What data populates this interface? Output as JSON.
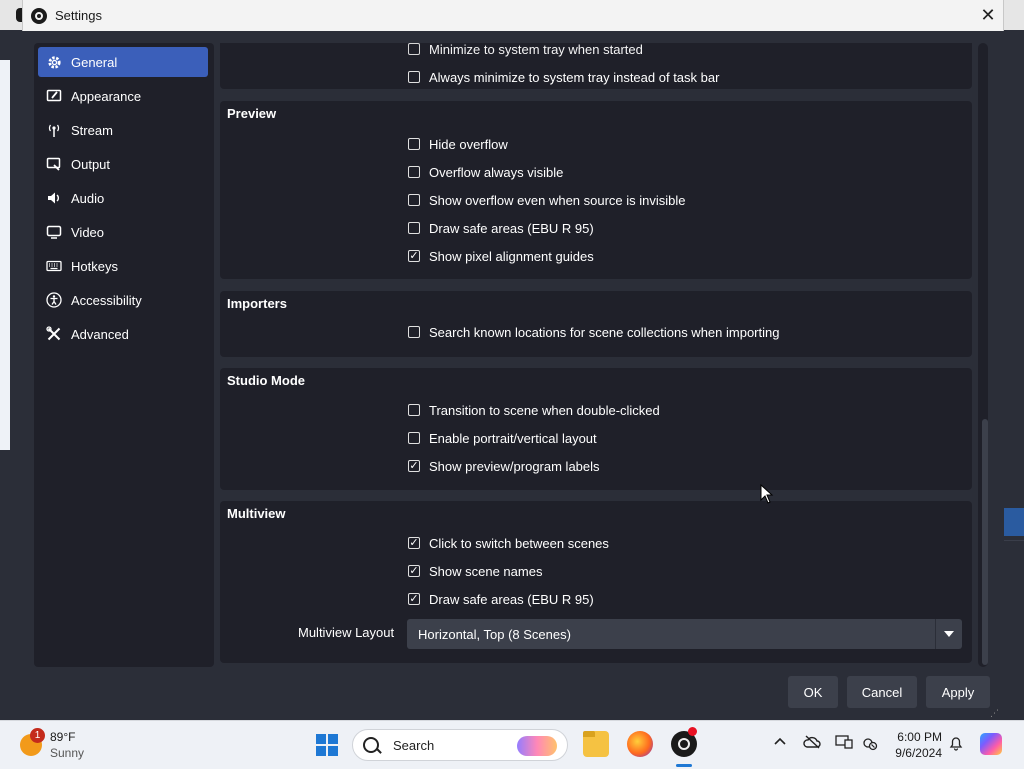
{
  "window": {
    "title": "Settings",
    "close_glyph": "✕"
  },
  "sidebar": {
    "items": [
      {
        "label": "General",
        "icon": "gear-icon",
        "active": true
      },
      {
        "label": "Appearance",
        "icon": "appearance-icon",
        "active": false
      },
      {
        "label": "Stream",
        "icon": "antenna-icon",
        "active": false
      },
      {
        "label": "Output",
        "icon": "output-icon",
        "active": false
      },
      {
        "label": "Audio",
        "icon": "speaker-icon",
        "active": false
      },
      {
        "label": "Video",
        "icon": "monitor-icon",
        "active": false
      },
      {
        "label": "Hotkeys",
        "icon": "keyboard-icon",
        "active": false
      },
      {
        "label": "Accessibility",
        "icon": "accessibility-icon",
        "active": false
      },
      {
        "label": "Advanced",
        "icon": "tools-icon",
        "active": false
      }
    ]
  },
  "sections": {
    "top": {
      "items": [
        {
          "label": "Minimize to system tray when started",
          "checked": false
        },
        {
          "label": "Always minimize to system tray instead of task bar",
          "checked": false
        }
      ]
    },
    "preview": {
      "title": "Preview",
      "items": [
        {
          "label": "Hide overflow",
          "checked": false
        },
        {
          "label": "Overflow always visible",
          "checked": false
        },
        {
          "label": "Show overflow even when source is invisible",
          "checked": false
        },
        {
          "label": "Draw safe areas (EBU R 95)",
          "checked": false
        },
        {
          "label": "Show pixel alignment guides",
          "checked": true
        }
      ]
    },
    "importers": {
      "title": "Importers",
      "items": [
        {
          "label": "Search known locations for scene collections when importing",
          "checked": false
        }
      ]
    },
    "studio_mode": {
      "title": "Studio Mode",
      "items": [
        {
          "label": "Transition to scene when double-clicked",
          "checked": false
        },
        {
          "label": "Enable portrait/vertical layout",
          "checked": false
        },
        {
          "label": "Show preview/program labels",
          "checked": true
        }
      ]
    },
    "multiview": {
      "title": "Multiview",
      "items": [
        {
          "label": "Click to switch between scenes",
          "checked": true
        },
        {
          "label": "Show scene names",
          "checked": true
        },
        {
          "label": "Draw safe areas (EBU R 95)",
          "checked": true
        }
      ],
      "layout_label": "Multiview Layout",
      "layout_value": "Horizontal, Top (8 Scenes)"
    }
  },
  "buttons": {
    "ok": "OK",
    "cancel": "Cancel",
    "apply": "Apply"
  },
  "taskbar": {
    "weather_badge": "1",
    "weather_temp": "89°F",
    "weather_cond": "Sunny",
    "search_placeholder": "Search",
    "time": "6:00 PM",
    "date": "9/6/2024"
  },
  "colors": {
    "accent": "#3b5fba",
    "dialog_bg": "#2b2e38",
    "panel_bg": "#1f2029",
    "control_bg": "#3c404b"
  }
}
